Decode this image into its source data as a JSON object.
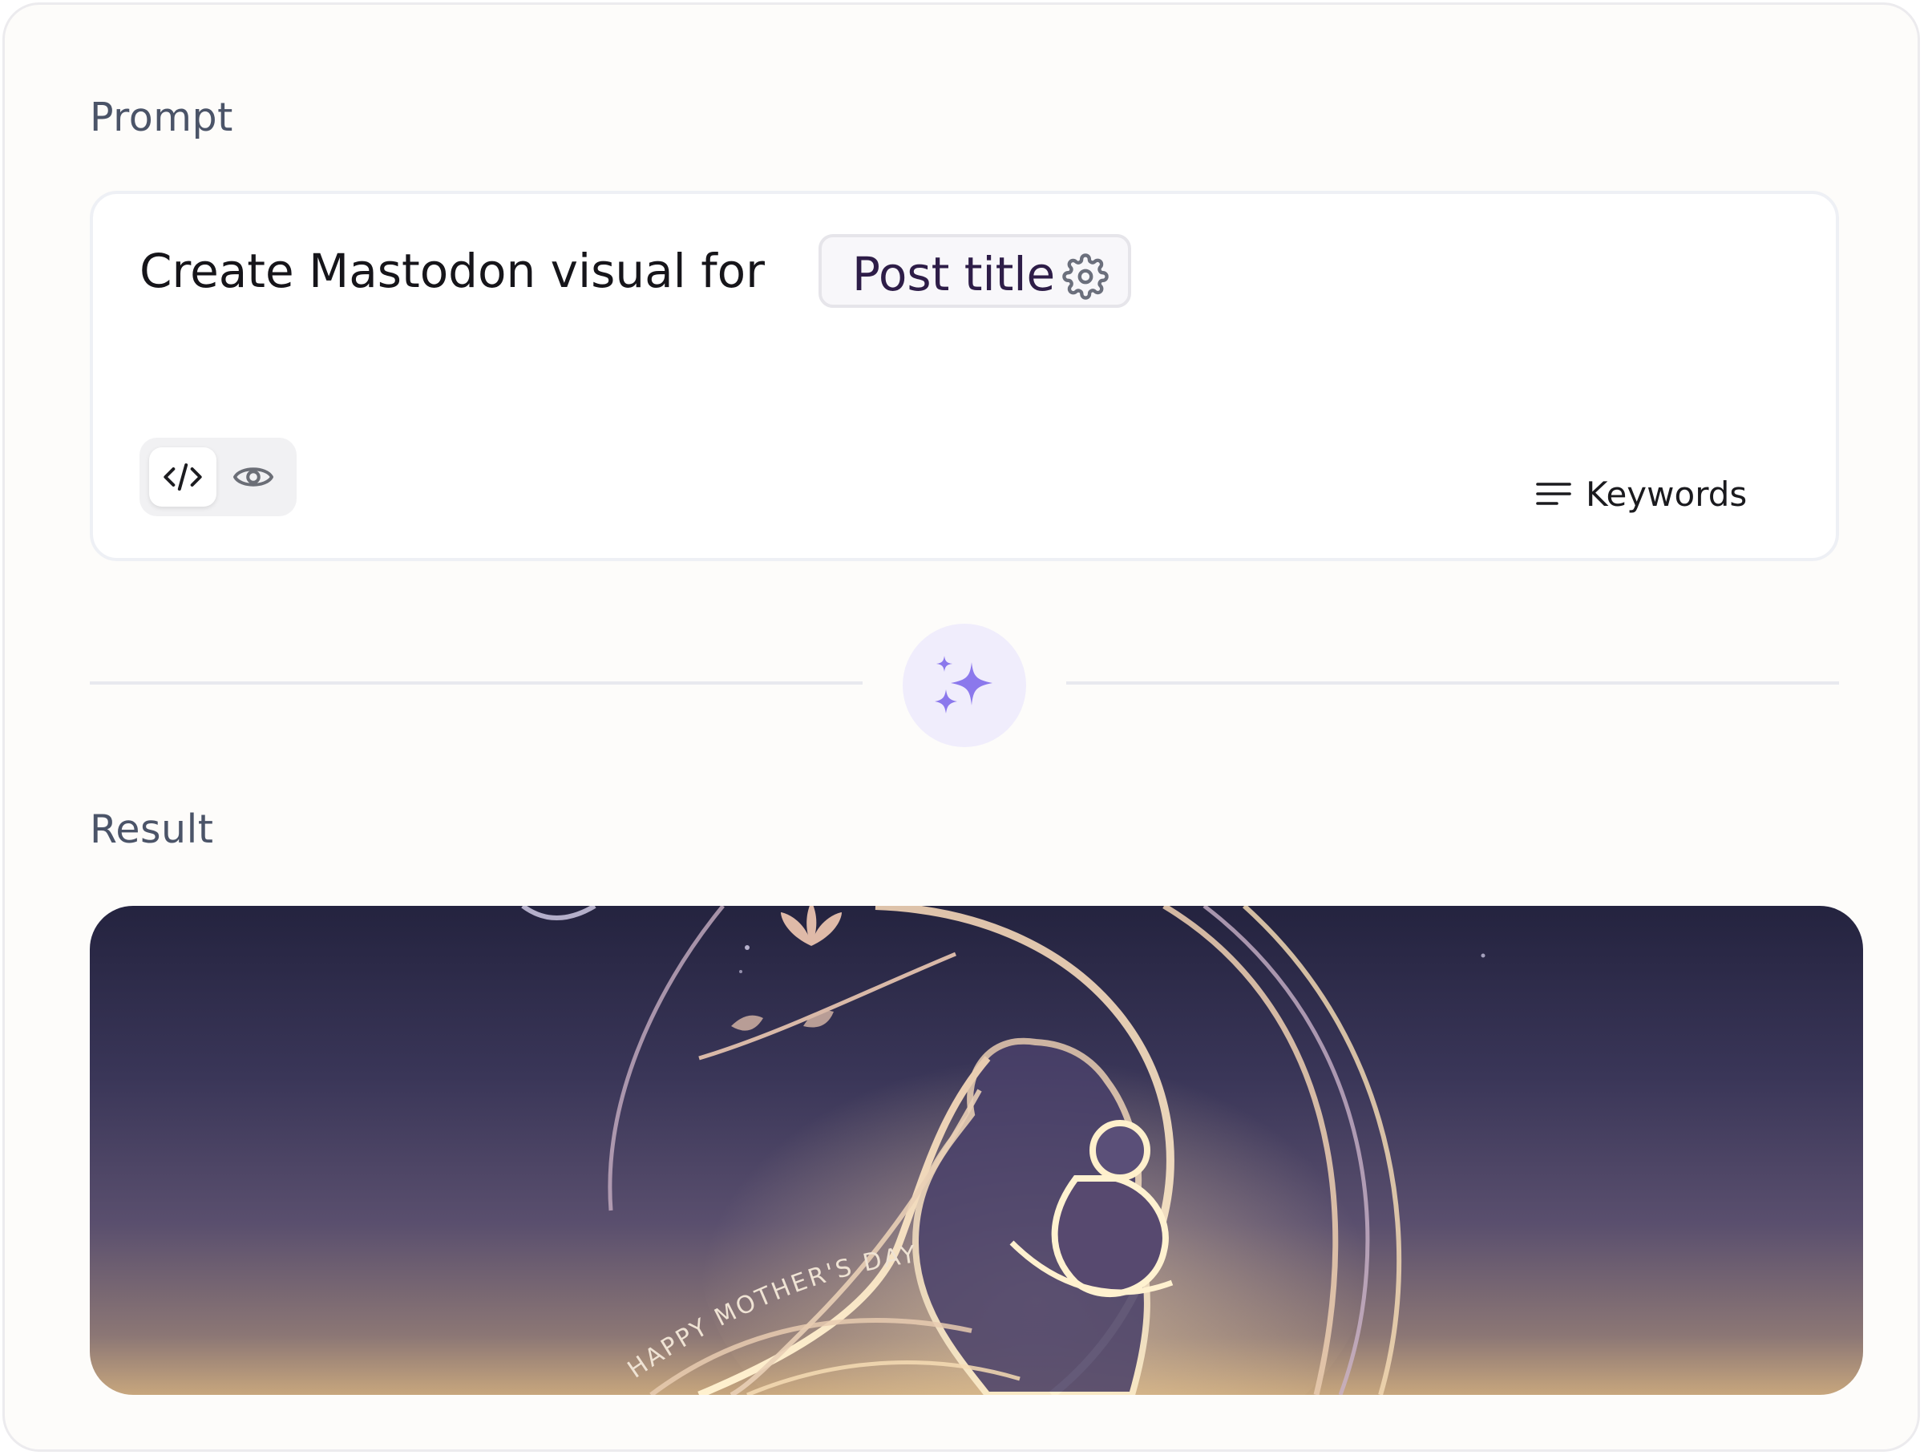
{
  "prompt_section": {
    "label": "Prompt",
    "text": "Create Mastodon visual for",
    "variable_chip": {
      "label": "Post title",
      "icon": "gear-icon"
    },
    "mode_toggle": {
      "code_icon": "code-icon",
      "preview_icon": "eye-icon",
      "active": "code"
    },
    "keywords": {
      "label": "Keywords",
      "icon": "lines-icon"
    }
  },
  "generate": {
    "icon": "sparkles-icon",
    "accent": "#8b78ec",
    "background": "#f0edfc"
  },
  "result_section": {
    "label": "Result",
    "image_text": "HAPPY MOTHER'S DAY"
  }
}
